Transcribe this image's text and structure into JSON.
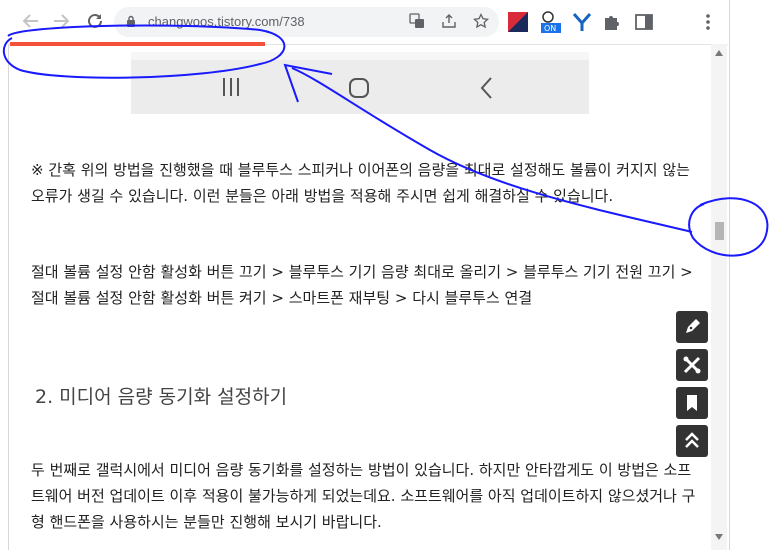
{
  "browser": {
    "url": "changwoos.tistory.com/738",
    "accent": "#f4513a"
  },
  "content": {
    "note": "※ 간혹 위의 방법을 진행했을 때 블루투스 스피커나 이어폰의 음량을 최대로 설정해도 볼륨이 커지지 않는 오류가 생길 수 있습니다. 이런 분들은 아래 방법을 적용해 주시면 쉽게 해결하실 수 있습니다.",
    "steps": "절대 볼륨 설정 안함 활성화 버튼 끄기 > 블루투스 기기 음량 최대로 올리기 > 블루투스 기기 전원 끄기 > 절대 볼륨 설정 안함 활성화 버튼 켜기 > 스마트폰 재부팅 > 다시 블루투스 연결",
    "heading": "2. 미디어 음량 동기화 설정하기",
    "body": "두 번째로 갤럭시에서 미디어 음량 동기화를 설정하는 방법이 있습니다. 하지만 안타깝게도 이 방법은 소프트웨어 버전 업데이트 이후 적용이 불가능하게 되었는데요. 소프트웨어를 아직 업데이트하지 않으셨거나 구형 핸드폰을 사용하시는 분들만 진행해 보시기 바랍니다."
  },
  "floating_buttons": [
    "write-icon",
    "tools-icon",
    "bookmark-icon",
    "scroll-top-icon"
  ],
  "annotation": {
    "color": "#1a1aff"
  }
}
